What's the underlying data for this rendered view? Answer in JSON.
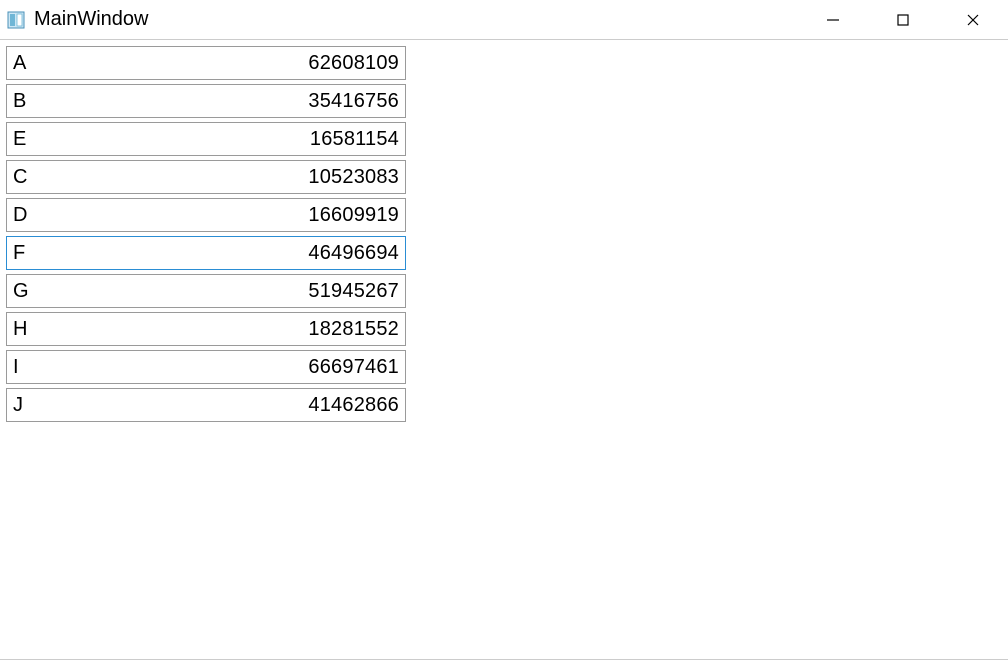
{
  "window": {
    "title": "MainWindow"
  },
  "controls": {
    "minimize": "minimize",
    "maximize": "maximize",
    "close": "close"
  },
  "list": {
    "selectedIndex": 5,
    "items": [
      {
        "label": "A",
        "value": "62608109"
      },
      {
        "label": "B",
        "value": "35416756"
      },
      {
        "label": "E",
        "value": "16581154"
      },
      {
        "label": "C",
        "value": "10523083"
      },
      {
        "label": "D",
        "value": "16609919"
      },
      {
        "label": "F",
        "value": "46496694"
      },
      {
        "label": "G",
        "value": "51945267"
      },
      {
        "label": "H",
        "value": "18281552"
      },
      {
        "label": "I",
        "value": "66697461"
      },
      {
        "label": "J",
        "value": "41462866"
      }
    ]
  }
}
